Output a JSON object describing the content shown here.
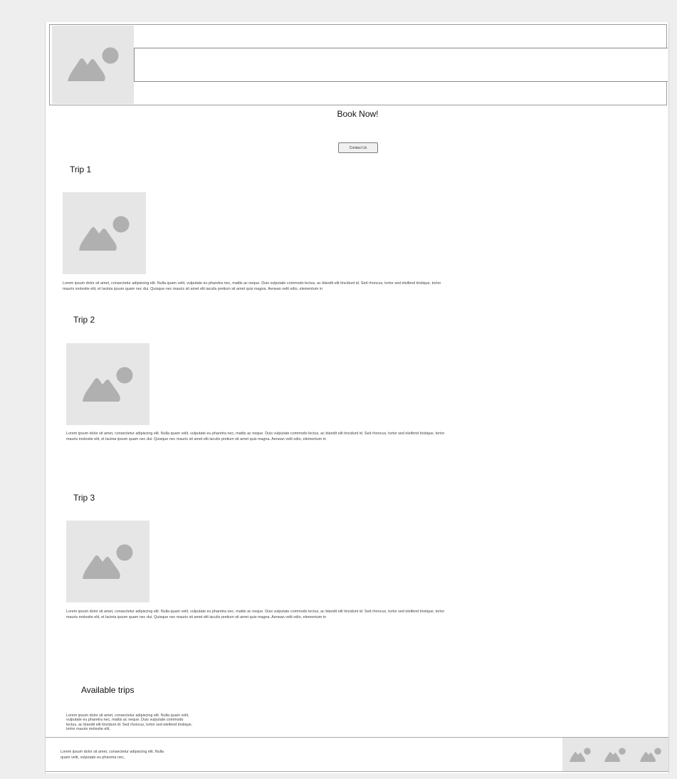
{
  "hero": {
    "cta_text": "Book Now!",
    "contact_button": "Contact Us"
  },
  "trips": [
    {
      "title": "Trip 1",
      "description": "Lorem ipsum dolor sit amet, consectetur adipiscing elit. Nulla quam velit, vulputate eu pharetra nec, mattis ac neque. Duis vulputate commodo lectus, ac blandit elit tincidunt id. Sed rhoncus, tortor sed eleifend tristique, tortor mauris molestie elit, et lacinia ipsum quam nec dui. Quisque nec mauris sit amet elit iaculis pretium sit amet quis magna. Aenean velit odio, elementum in"
    },
    {
      "title": "Trip 2",
      "description": "Lorem ipsum dolor sit amet, consectetur adipiscing elit. Nulla quam velit, vulputate eu pharetra nec, mattis ac neque. Duis vulputate commodo lectus, ac blandit elit tincidunt id. Sed rhoncus, tortor sed eleifend tristique, tortor mauris molestie elit, et lacinia ipsum quam nec dui. Quisque nec mauris sit amet elit iaculis pretium sit amet quis magna. Aenean velit odio, elementum in"
    },
    {
      "title": "Trip 3",
      "description": "Lorem ipsum dolor sit amet, consectetur adipiscing elit. Nulla quam velit, vulputate eu pharetra nec, mattis ac neque. Duis vulputate commodo lectus, ac blandit elit tincidunt id. Sed rhoncus, tortor sed eleifend tristique, tortor mauris molestie elit, et lacinia ipsum quam nec dui. Quisque nec mauris sit amet elit iaculis pretium sit amet quis magna. Aenean velit odio, elementum in"
    }
  ],
  "available": {
    "title": "Available trips",
    "description": "Lorem ipsum dolor sit amet, consectetur adipiscing elit. Nulla quam velit, vulputate eu pharetra nec, mattis ac neque. Duis vulputate commodo lectus, ac blandit elit tincidunt id. Sed rhoncus, tortor sed eleifend tristique, tortor mauris molestie elit,"
  },
  "footer": {
    "text": "Lorem ipsum dolor sit amet, consectetur adipiscing elit. Nulla quam velit, vulputate eu pharetra nec,"
  },
  "icons": {
    "image_placeholder": "image-placeholder-icon"
  },
  "colors": {
    "page_background": "#eeeeee",
    "placeholder_fill": "#e6e6e6",
    "placeholder_glyph": "#b0b0b0",
    "border": "#9a9a9a"
  }
}
